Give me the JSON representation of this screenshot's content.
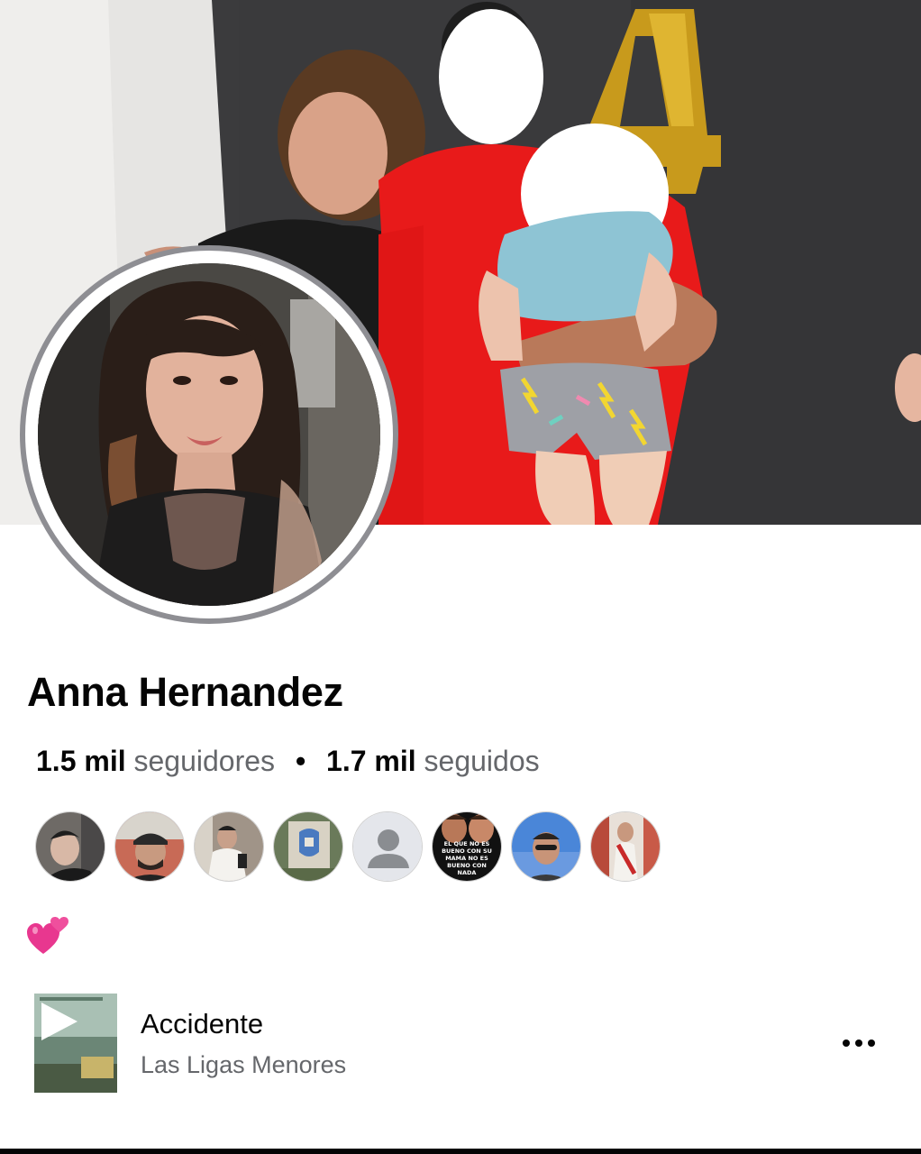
{
  "profile": {
    "name": "Anna Hernandez",
    "followers_count": "1.5 mil",
    "followers_label": "seguidores",
    "separator": "•",
    "following_count": "1.7 mil",
    "following_label": "seguidos",
    "bio_emoji": "two-hearts-icon"
  },
  "cover": {
    "balloon_digit": "4"
  },
  "friends": [
    {
      "name": "friend-1"
    },
    {
      "name": "friend-2"
    },
    {
      "name": "friend-3"
    },
    {
      "name": "friend-4"
    },
    {
      "name": "friend-5-default"
    },
    {
      "name": "friend-6",
      "text": "El que no es bueno con su mama no es bueno con nada"
    },
    {
      "name": "friend-7"
    },
    {
      "name": "friend-8"
    }
  ],
  "music": {
    "title": "Accidente",
    "artist": "Las Ligas Menores",
    "play_icon": "play-icon",
    "more_icon": "more-options-icon"
  },
  "colors": {
    "ring": "#8e8e93",
    "text_primary": "#050505",
    "text_secondary": "#65676b",
    "heart": "#e8378f"
  }
}
